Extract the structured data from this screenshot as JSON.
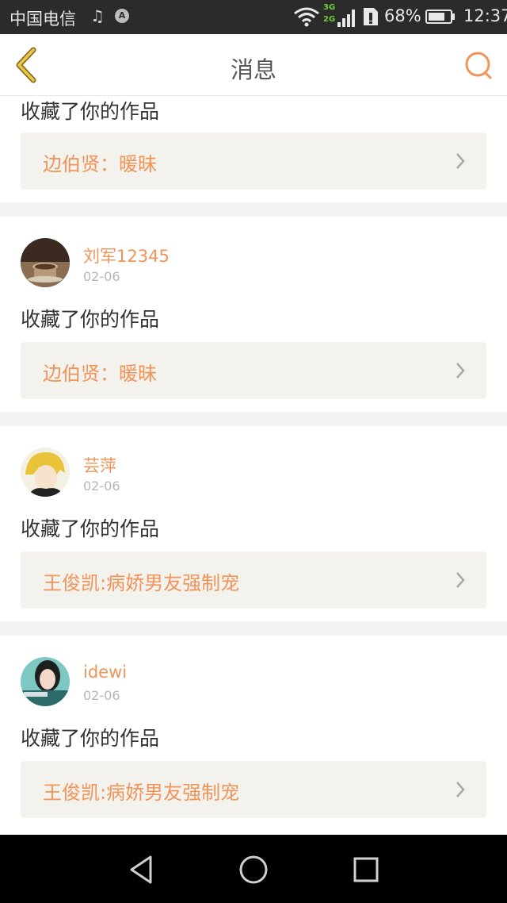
{
  "status_bar": {
    "carrier": "中国电信",
    "network_top": "3G",
    "network_bottom": "2G",
    "battery_percent": "68%",
    "time": "12:37",
    "icons": [
      "music-note-icon",
      "app-notification-icon",
      "wifi-icon",
      "signal-icon",
      "sim-alert-icon",
      "battery-icon"
    ]
  },
  "header": {
    "title": "消息",
    "back_icon": "chevron-left-icon",
    "search_icon": "search-icon"
  },
  "colors": {
    "accent": "#f0945a",
    "back_icon": "#c9a13a",
    "card_link_bg": "#f3f2ec",
    "page_bg": "#f3f3f3"
  },
  "messages": [
    {
      "action": "收藏了你的作品",
      "work": "边伯贤：暖昧"
    },
    {
      "username": "刘军12345",
      "date": "02-06",
      "action": "收藏了你的作品",
      "work": "边伯贤：暖昧"
    },
    {
      "username": "芸萍",
      "date": "02-06",
      "action": "收藏了你的作品",
      "work": "王俊凯:病娇男友强制宠"
    },
    {
      "username": "idewi",
      "date": "02-06",
      "action": "收藏了你的作品",
      "work": "王俊凯:病娇男友强制宠"
    }
  ],
  "nav_bar": {
    "icons": [
      "back-triangle-icon",
      "home-circle-icon",
      "recents-square-icon"
    ]
  }
}
